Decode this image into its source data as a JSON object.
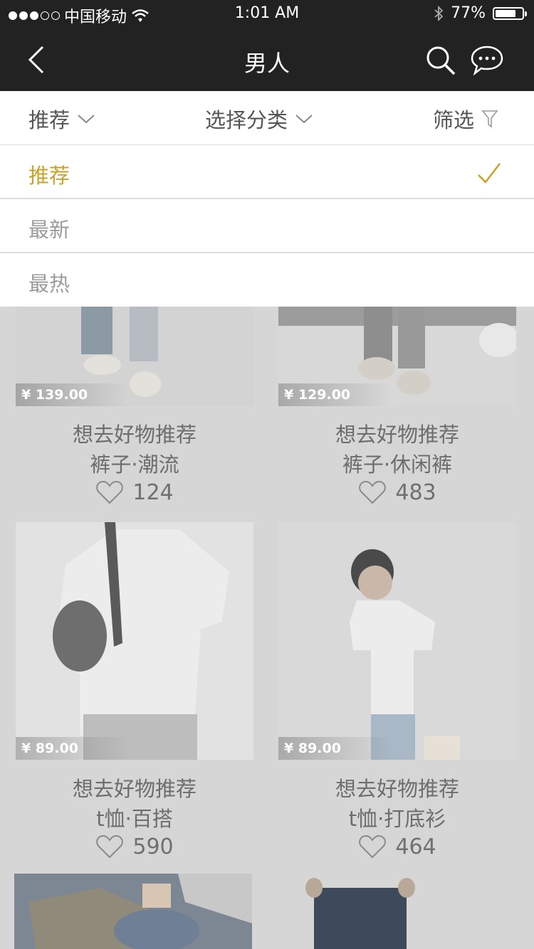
{
  "status_bar": {
    "carrier": "中国移动",
    "time": "1:01 AM",
    "battery": "77%",
    "battery_level": 0.77
  },
  "nav": {
    "title": "男人"
  },
  "filters": {
    "sort_label": "推荐",
    "category_label": "选择分类",
    "filter_label": "筛选"
  },
  "sort_menu": {
    "items": [
      {
        "label": "推荐",
        "selected": true
      },
      {
        "label": "最新",
        "selected": false
      },
      {
        "label": "最热",
        "selected": false
      }
    ],
    "accent_color": "#c9a227"
  },
  "products": [
    {
      "price": "¥ 139.00",
      "title": "想去好物推荐",
      "subtitle": "裤子·潮流",
      "likes": "124"
    },
    {
      "price": "¥ 129.00",
      "title": "想去好物推荐",
      "subtitle": "裤子·休闲裤",
      "likes": "483"
    },
    {
      "price": "¥ 89.00",
      "title": "想去好物推荐",
      "subtitle": "t恤·百搭",
      "likes": "590"
    },
    {
      "price": "¥ 89.00",
      "title": "想去好物推荐",
      "subtitle": "t恤·打底衫",
      "likes": "464"
    }
  ]
}
